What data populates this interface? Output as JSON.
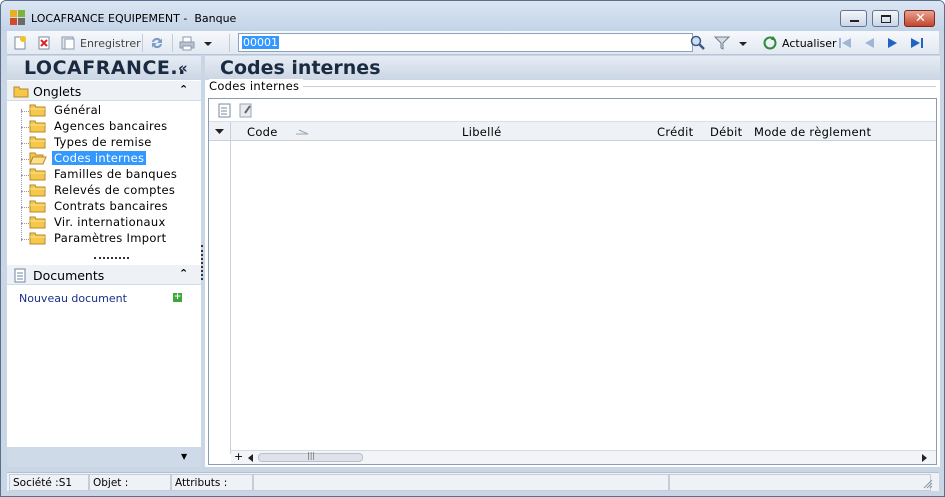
{
  "window": {
    "title": "LOCAFRANCE EQUIPEMENT -  Banque"
  },
  "toolbar": {
    "save_label": "Enregistrer",
    "search_value": "00001",
    "refresh_label": "Actualiser"
  },
  "sidebar": {
    "brand": "LOCAFRANCE..",
    "brand_collapse": "«",
    "onglets_header": "Onglets",
    "items": [
      {
        "label": "Général"
      },
      {
        "label": "Agences bancaires"
      },
      {
        "label": "Types de remise"
      },
      {
        "label": "Codes internes"
      },
      {
        "label": "Familles de banques"
      },
      {
        "label": "Relevés de comptes"
      },
      {
        "label": "Contrats bancaires"
      },
      {
        "label": "Vir. internationaux"
      },
      {
        "label": "Paramètres Import"
      }
    ],
    "selected_index": 3,
    "documents_header": "Documents",
    "new_document_label": "Nouveau document"
  },
  "main": {
    "title": "Codes internes",
    "group_label": "Codes internes",
    "columns": [
      "Code",
      "Libellé",
      "Crédit",
      "Débit",
      "Mode de règlement"
    ]
  },
  "status": {
    "societe": "Société :S1",
    "objet": "Objet :",
    "attributs": "Attributs :"
  },
  "colors": {
    "selection": "#3399ff",
    "window_frame": "#c9d6e6",
    "brand_text": "#1a2a40",
    "link": "#1a2f8a"
  }
}
